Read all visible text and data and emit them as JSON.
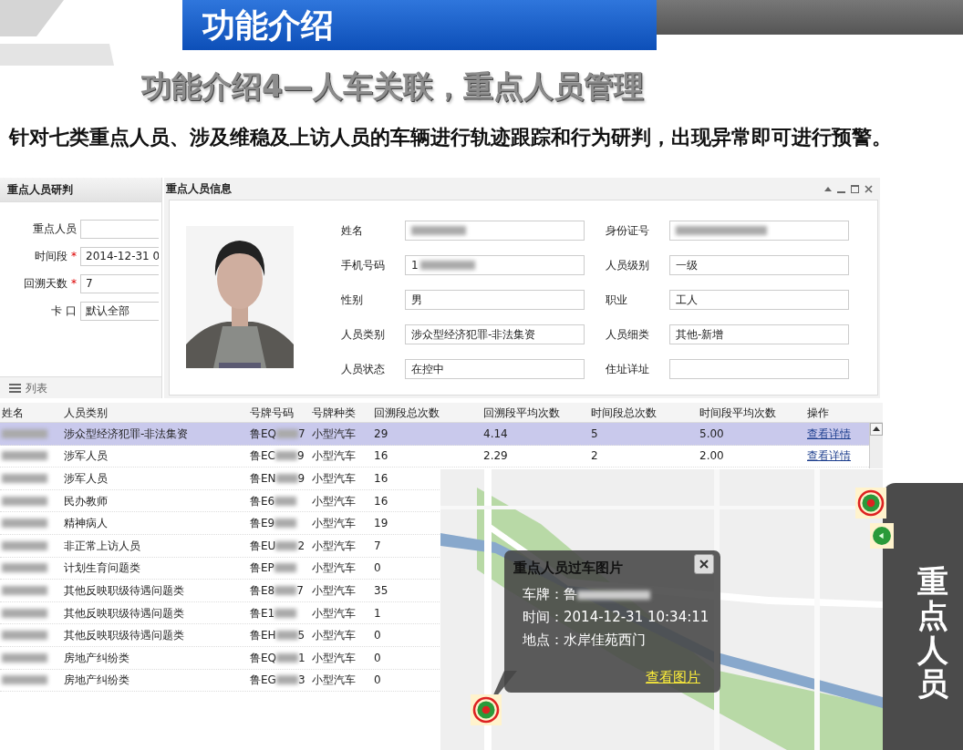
{
  "slide": {
    "header_title": "功能介绍",
    "subtitle": "功能介绍4—人车关联，重点人员管理",
    "description": "针对七类重点人员、涉及维稳及上访人员的车辆进行轨迹跟踪和行为研判，出现异常即可进行预警。"
  },
  "search_panel": {
    "title": "重点人员研判",
    "fields": [
      {
        "label": "重点人员"
      },
      {
        "label": "时间段",
        "required_mark": "*",
        "value": "2014-12-31 0"
      },
      {
        "label": "回溯天数",
        "required_mark": "*",
        "value": "7"
      },
      {
        "label": "卡 口",
        "value": "默认全部"
      }
    ],
    "list_tab": "列表"
  },
  "info_window": {
    "title": "重点人员信息",
    "fields": [
      {
        "label": "姓名",
        "redacted": true
      },
      {
        "label": "身份证号",
        "redacted": true
      },
      {
        "label": "手机号码",
        "value": "1",
        "redacted": true
      },
      {
        "label": "人员级别",
        "value": "一级"
      },
      {
        "label": "性别",
        "value": "男"
      },
      {
        "label": "职业",
        "value": "工人"
      },
      {
        "label": "人员类别",
        "value": "涉众型经济犯罪-非法集资"
      },
      {
        "label": "人员细类",
        "value": "其他-新增"
      },
      {
        "label": "人员状态",
        "value": "在控中"
      },
      {
        "label": "住址详址"
      }
    ]
  },
  "table": {
    "columns": [
      "姓名",
      "人员类别",
      "号牌号码",
      "号牌种类",
      "回溯段总次数",
      "回溯段平均次数",
      "时间段总次数",
      "时间段平均次数",
      "操作"
    ],
    "rows": [
      {
        "selected": true,
        "category": "涉众型经济犯罪-非法集资",
        "plate": {
          "start": "鲁EQ",
          "end": "7"
        },
        "plate_type": "小型汽车",
        "cells": [
          "29",
          "4.14",
          "5",
          "5.00"
        ],
        "action": "查看详情"
      },
      {
        "selected": false,
        "category": "涉军人员",
        "plate": {
          "start": "鲁EC",
          "end": "9"
        },
        "plate_type": "小型汽车",
        "cells": [
          "16",
          "2.29",
          "2",
          "2.00"
        ],
        "action": "查看详情"
      },
      {
        "selected": false,
        "category": "涉军人员",
        "plate": {
          "start": "鲁EN",
          "end": "9"
        },
        "plate_type": "小型汽车",
        "cells": [
          "16"
        ]
      },
      {
        "selected": false,
        "category": "民办教师",
        "plate": {
          "start": "鲁E6"
        },
        "plate_type": "小型汽车",
        "cells": [
          "16"
        ]
      },
      {
        "selected": false,
        "category": "精神病人",
        "plate": {
          "start": "鲁E9"
        },
        "plate_type": "小型汽车",
        "cells": [
          "19"
        ]
      },
      {
        "selected": false,
        "category": "非正常上访人员",
        "plate": {
          "start": "鲁EU",
          "end": "2"
        },
        "plate_type": "小型汽车",
        "cells": [
          "7"
        ]
      },
      {
        "selected": false,
        "category": "计划生育问题类",
        "plate": {
          "start": "鲁EP"
        },
        "plate_type": "小型汽车",
        "cells": [
          "0"
        ]
      },
      {
        "selected": false,
        "category": "其他反映职级待遇问题类",
        "plate": {
          "start": "鲁E8",
          "end": "7"
        },
        "plate_type": "小型汽车",
        "cells": [
          "35"
        ]
      },
      {
        "selected": false,
        "category": "其他反映职级待遇问题类",
        "plate": {
          "start": "鲁E1"
        },
        "plate_type": "小型汽车",
        "cells": [
          "1"
        ]
      },
      {
        "selected": false,
        "category": "其他反映职级待遇问题类",
        "plate": {
          "start": "鲁EH",
          "end": "5"
        },
        "plate_type": "小型汽车",
        "cells": [
          "0"
        ]
      },
      {
        "selected": false,
        "category": "房地产纠纷类",
        "plate": {
          "start": "鲁EQ",
          "end": "1"
        },
        "plate_type": "小型汽车",
        "cells": [
          "0"
        ]
      },
      {
        "selected": false,
        "category": "房地产纠纷类",
        "plate": {
          "start": "鲁EG",
          "end": "3"
        },
        "plate_type": "小型汽车",
        "cells": [
          "0"
        ]
      }
    ]
  },
  "map": {
    "popup": {
      "title": "重点人员过车图片",
      "lines": [
        {
          "label": "车牌：",
          "value": "鲁",
          "redacted": true
        },
        {
          "label": "时间：",
          "value": "2014-12-31 10:34:11"
        },
        {
          "label": "地点：",
          "value": "水岸佳苑西门"
        }
      ],
      "link": "查看图片"
    }
  },
  "side_tab": {
    "label": "重点人员"
  }
}
